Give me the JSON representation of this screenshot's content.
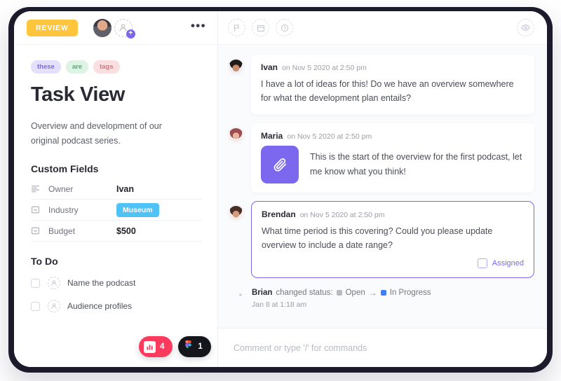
{
  "left": {
    "status_badge": "REVIEW",
    "menu_icon": "•••",
    "tags": [
      "these",
      "are",
      "tags"
    ],
    "title": "Task View",
    "description": "Overview and development of our original podcast series.",
    "custom_fields_title": "Custom Fields",
    "fields": [
      {
        "icon": "text-lines-icon",
        "label": "Owner",
        "value": "Ivan",
        "type": "text"
      },
      {
        "icon": "dropdown-icon",
        "label": "Industry",
        "value": "Museum",
        "type": "badge"
      },
      {
        "icon": "dropdown-icon",
        "label": "Budget",
        "value": "$500",
        "type": "text"
      }
    ],
    "todo_title": "To Do",
    "todos": [
      {
        "label": "Name the podcast",
        "checked": false
      },
      {
        "label": "Audience profiles",
        "checked": false
      }
    ],
    "badges": [
      {
        "name": "app-badge",
        "count": "4",
        "color": "#fb3a5d"
      },
      {
        "name": "figma-badge",
        "count": "1",
        "color": "#15151c"
      }
    ]
  },
  "right": {
    "toolbar": {
      "flag": "flag-icon",
      "calendar": "calendar-icon",
      "clock": "clock-icon",
      "watch": "eye-icon"
    },
    "comments": [
      {
        "author": "Ivan",
        "time": "on Nov 5 2020 at 2:50 pm",
        "text": "I have a lot of ideas for this! Do we have an overview somewhere for what the development plan entails?",
        "has_attachment": false,
        "highlighted": false
      },
      {
        "author": "Maria",
        "time": "on Nov 5 2020 at 2:50 pm",
        "text": "This is the start of the overview for the first podcast, let me know what you think!",
        "has_attachment": true,
        "attachment_icon": "paperclip-icon",
        "highlighted": false
      },
      {
        "author": "Brendan",
        "time": "on Nov 5 2020 at 2:50 pm",
        "text": "What time period is this covering? Could you please update overview to include a date range?",
        "has_attachment": false,
        "highlighted": true,
        "assigned_label": "Assigned",
        "assigned_checked": false
      }
    ],
    "status_change": {
      "actor": "Brian",
      "action": "changed status:",
      "from": "Open",
      "from_color": "#b7bac3",
      "arrow": "→",
      "to": "In Progress",
      "to_color": "#3b7ffb",
      "timestamp": "Jan 8 at 1:18 am"
    },
    "composer": {
      "placeholder": "Comment or type '/' for commands",
      "value": ""
    }
  }
}
